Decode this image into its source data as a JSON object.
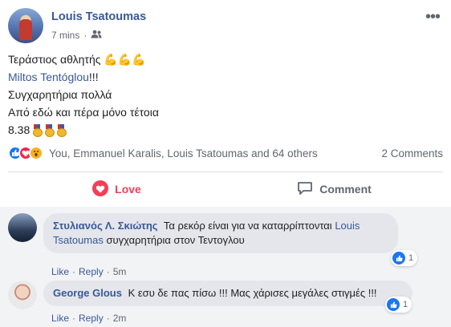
{
  "post": {
    "author": "Louis Tsatoumas",
    "time": "7 mins",
    "privacy_icon": "friends-icon",
    "more": "•••",
    "lines": {
      "l1_text": "Τεράστιος αθλητής",
      "l1_emoji": "💪💪💪",
      "l2_link": "Miltos Tentóglou",
      "l2_suffix": "!!!",
      "l3": "Συγχαρητήρια πολλά",
      "l4": "Από εδώ και πέρα μόνο τέτοια",
      "l5_text": "8.38"
    }
  },
  "reactions": {
    "icons": [
      "like-icon",
      "love-icon",
      "wow-icon"
    ],
    "summary": "You, Emmanuel Karalis, Louis Tsatoumas and 64 others",
    "comments_count": "2 Comments"
  },
  "actions": {
    "love_label": "Love",
    "comment_label": "Comment"
  },
  "comments": [
    {
      "author": "Στυλιανός Λ. Σκιώτης",
      "text_before": "Τα ρεκόρ είναι για να καταρρίπτονται",
      "mention_1": "Louis",
      "mention_2": "Tsatoumas",
      "text_after": "συγχαρητήρια στον Τεντογλου",
      "like": "Like",
      "reply": "Reply",
      "time": "5m",
      "reaction_count": "1"
    },
    {
      "author": "George Glous",
      "text": "Κ εσυ δε πας πίσω !!! Μας χάρισες μεγάλες στιγμές !!!",
      "like": "Like",
      "reply": "Reply",
      "time": "2m",
      "reaction_count": "1"
    }
  ],
  "colors": {
    "link": "#385898",
    "love": "#f33e58",
    "like_blue": "#1877f2",
    "comment_bg": "#f2f3f5",
    "bubble_bg": "#e4e6eb"
  }
}
